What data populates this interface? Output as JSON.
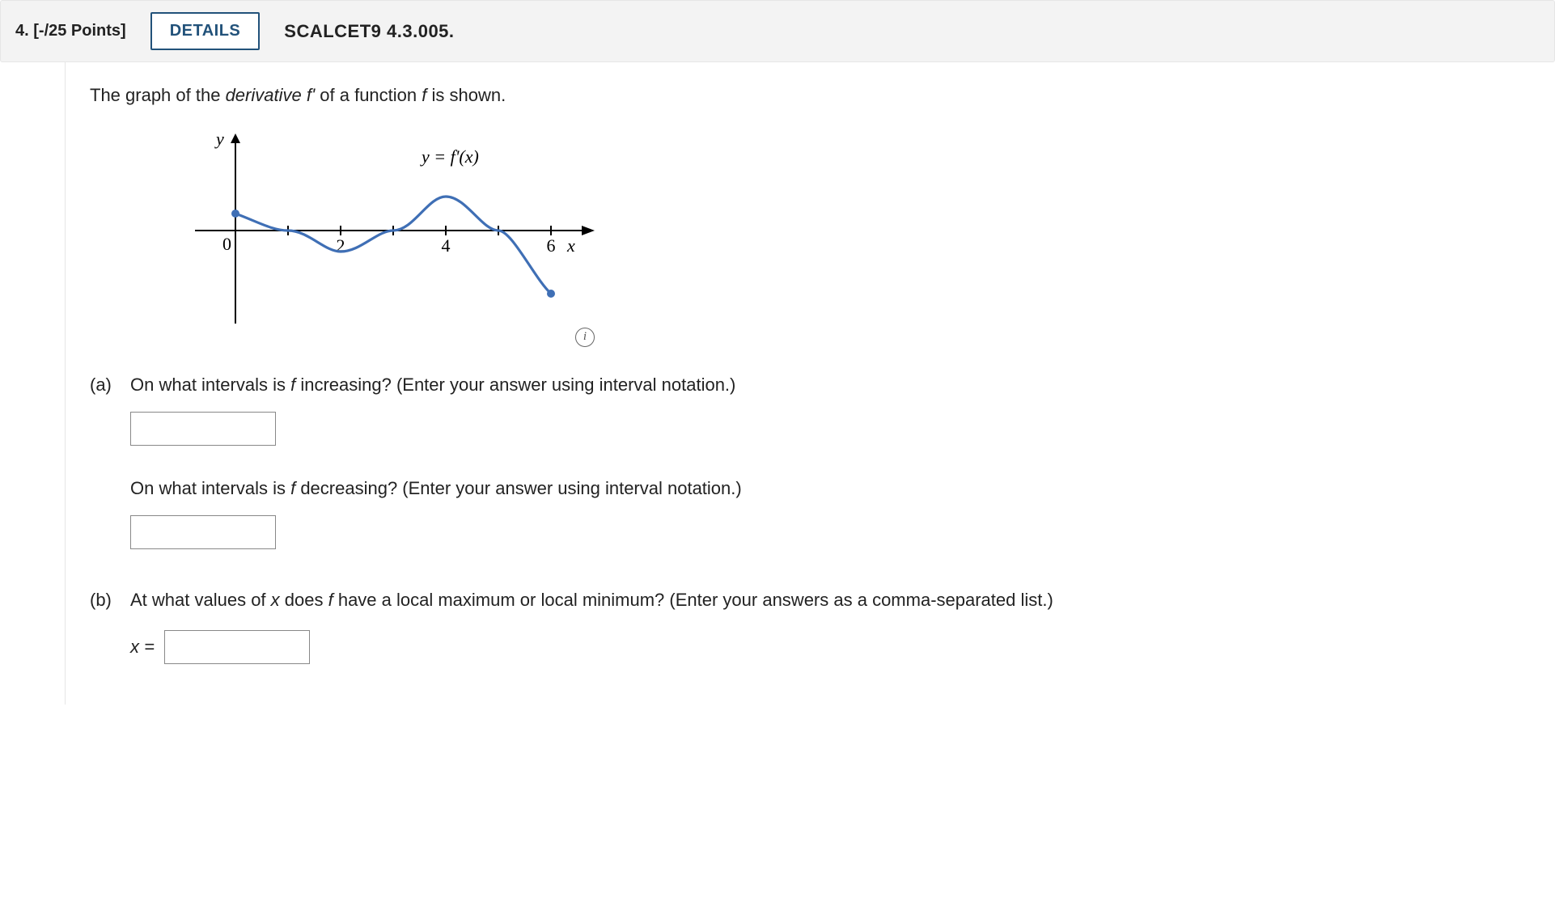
{
  "header": {
    "q_number": "4.",
    "points": "[-/25 Points]",
    "details_label": "DETAILS",
    "source": "SCALCET9 4.3.005."
  },
  "intro": {
    "pre": "The graph of the ",
    "italic1": "derivative f'",
    "mid": " of a function ",
    "italic2": "f",
    "post": " is shown."
  },
  "graph": {
    "y_label": "y",
    "x_label": "x",
    "curve_label": "y = f'(x)",
    "origin_label": "0",
    "ticks": [
      "2",
      "4",
      "6"
    ]
  },
  "info_icon_label": "i",
  "parts": {
    "a": {
      "label": "(a)",
      "q1_pre": "On what intervals is ",
      "q1_f": "f",
      "q1_post": " increasing? (Enter your answer using interval notation.)",
      "ans1": "",
      "q2_pre": "On what intervals is ",
      "q2_f": "f",
      "q2_post": " decreasing? (Enter your answer using interval notation.)",
      "ans2": ""
    },
    "b": {
      "label": "(b)",
      "q_pre": "At what values of ",
      "q_x": "x",
      "q_mid": " does ",
      "q_f": "f",
      "q_post": " have a local maximum or local minimum? (Enter your answers as a comma-separated list.)",
      "x_eq": "x =",
      "ans": ""
    }
  },
  "chart_data": {
    "type": "line",
    "title": "y = f'(x)",
    "xlabel": "x",
    "ylabel": "y",
    "xlim": [
      0,
      7
    ],
    "ylim": [
      -1.4,
      1
    ],
    "x_ticks": [
      2,
      4,
      6
    ],
    "series": [
      {
        "name": "f'(x)",
        "x": [
          0,
          0.5,
          1,
          1.5,
          2,
          2.5,
          3,
          3.5,
          4,
          4.5,
          5,
          5.5,
          6
        ],
        "values": [
          0.35,
          0.12,
          0,
          -0.3,
          -0.44,
          -0.3,
          0,
          0.55,
          0.7,
          0.55,
          0,
          -0.8,
          -1.3
        ]
      }
    ],
    "endpoints": [
      {
        "x": 0,
        "y": 0.35,
        "style": "closed"
      },
      {
        "x": 6,
        "y": -1.3,
        "style": "closed"
      }
    ],
    "x_intercepts": [
      1,
      3,
      5
    ]
  }
}
